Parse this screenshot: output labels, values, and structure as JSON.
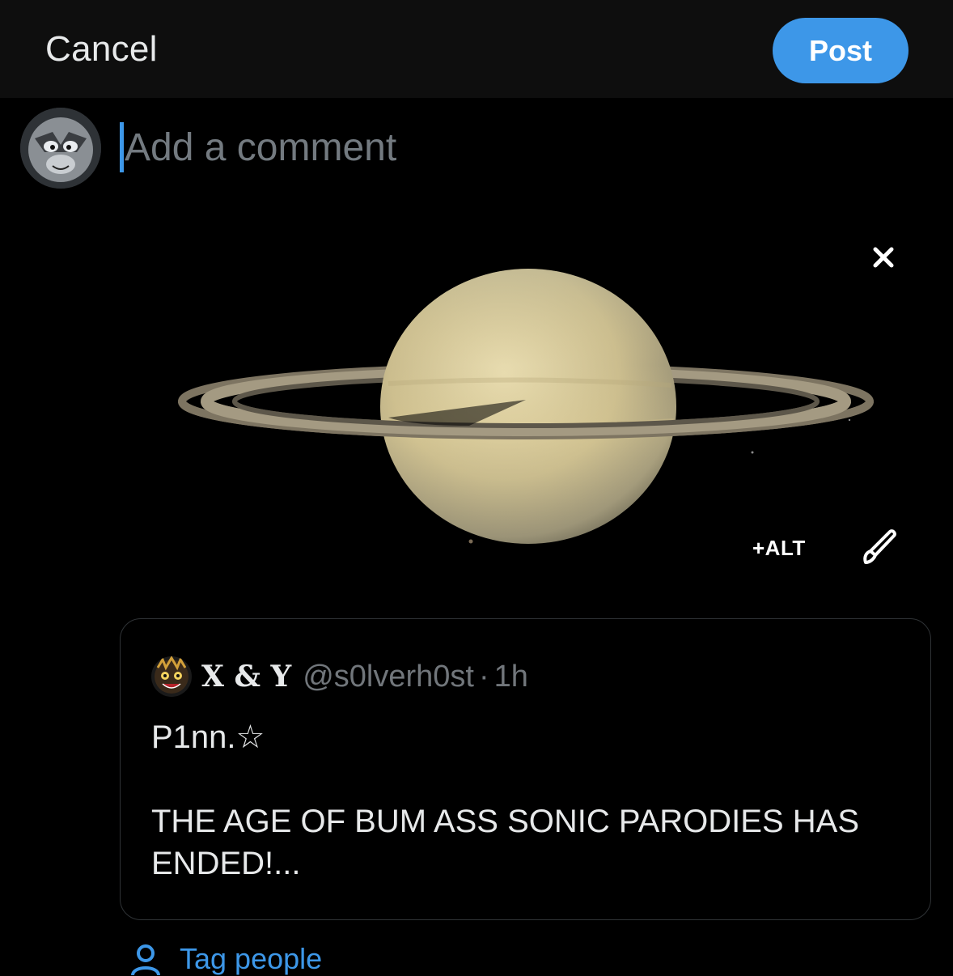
{
  "topbar": {
    "cancel_label": "Cancel",
    "post_label": "Post"
  },
  "composer": {
    "placeholder": "Add a comment",
    "value": ""
  },
  "media": {
    "alt_label": "+ALT",
    "icons": [
      "close-icon",
      "pencil-icon"
    ]
  },
  "quote": {
    "name": "X & Y",
    "handle": "@s0lverh0st",
    "separator": "·",
    "time": "1h",
    "text": "P1nn.☆\n\nTHE AGE OF BUM ASS SONIC PARODIES HAS ENDED!..."
  },
  "footer": {
    "tag_label": "Tag people",
    "tag_icon": "person-icon"
  },
  "colors": {
    "accent": "#3d97e8",
    "background": "#000000",
    "topbar": "#0e0e0e",
    "muted": "#71767b"
  }
}
